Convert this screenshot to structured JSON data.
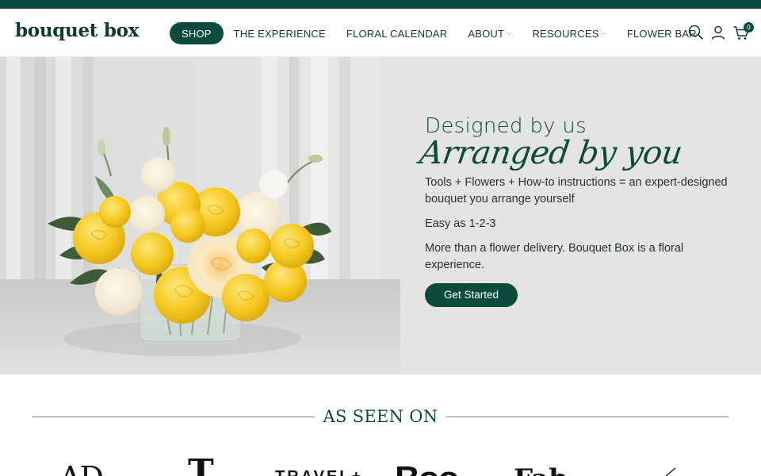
{
  "banner": {
    "text": "",
    "link_text": ""
  },
  "header": {
    "logo": "bouquet box",
    "nav": [
      {
        "label": "SHOP"
      },
      {
        "label": "THE EXPERIENCE"
      },
      {
        "label": "FLORAL CALENDAR"
      },
      {
        "label": "ABOUT"
      },
      {
        "label": "RESOURCES"
      },
      {
        "label": "FLOWER BAR"
      }
    ],
    "cart_count": "0",
    "icons": [
      "search-icon",
      "account-icon",
      "cart-icon"
    ]
  },
  "hero": {
    "headline_1": "Designed by us",
    "headline_2": "Arranged by you",
    "paragraphs": [
      "Tools + Flowers + How-to instructions = an expert-designed bouquet you arrange yourself",
      "Easy as 1-2-3",
      "More than a flower delivery. Bouquet Box is a floral experience."
    ],
    "cta_label": "Get Started"
  },
  "press": {
    "title": "AS SEEN ON",
    "logos": [
      "AD",
      "T",
      "TRAVEL+",
      "Boo",
      "Fab"
    ]
  },
  "colors": {
    "brand_green": "#0b4a3c",
    "hero_bg": "#e4e5e3",
    "rose_yellow": "#f4c51c",
    "rose_cream": "#f4ecd8"
  }
}
